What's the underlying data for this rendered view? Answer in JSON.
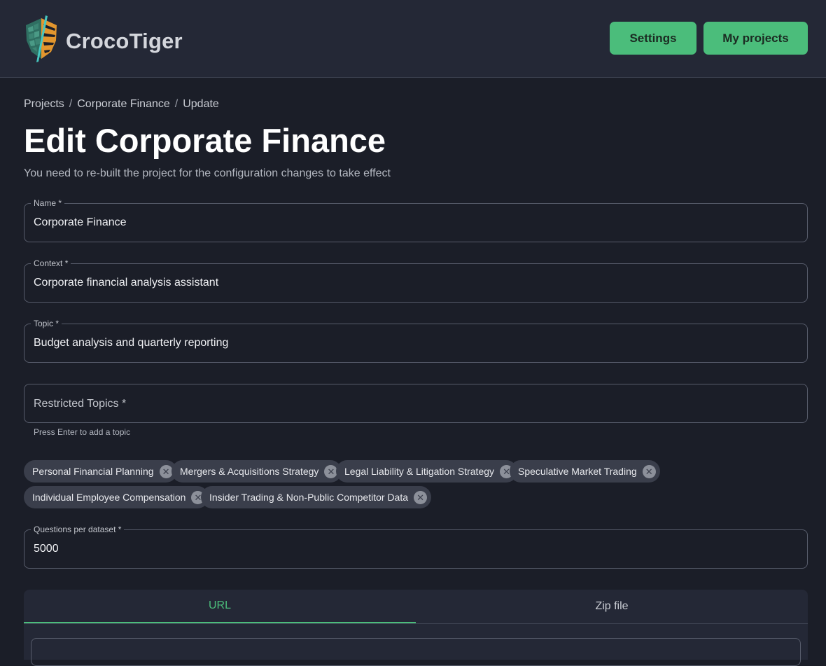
{
  "header": {
    "brand_name": "CrocoTiger",
    "settings_label": "Settings",
    "projects_label": "My projects"
  },
  "breadcrumb": {
    "items": [
      "Projects",
      "Corporate Finance",
      "Update"
    ],
    "separator": "/"
  },
  "page": {
    "title": "Edit Corporate Finance",
    "subtitle": "You need to re-built the project for the configuration changes to take effect"
  },
  "form": {
    "name": {
      "label": "Name *",
      "value": "Corporate Finance"
    },
    "context": {
      "label": "Context *",
      "value": "Corporate financial analysis assistant"
    },
    "topic": {
      "label": "Topic *",
      "value": "Budget analysis and quarterly reporting"
    },
    "restricted": {
      "placeholder": "Restricted Topics *",
      "helper": "Press Enter to add a topic",
      "chips": [
        "Personal Financial Planning",
        "Mergers & Acquisitions Strategy",
        "Legal Liability & Litigation Strategy",
        "Speculative Market Trading",
        "Individual Employee Compensation",
        "Insider Trading & Non-Public Competitor Data"
      ]
    },
    "questions": {
      "label": "Questions per dataset *",
      "value": "5000"
    }
  },
  "tabs": {
    "url_label": "URL",
    "zip_label": "Zip file",
    "active": "URL"
  },
  "colors": {
    "accent": "#4bbd7b",
    "background": "#1b1e28",
    "header": "#242836"
  }
}
